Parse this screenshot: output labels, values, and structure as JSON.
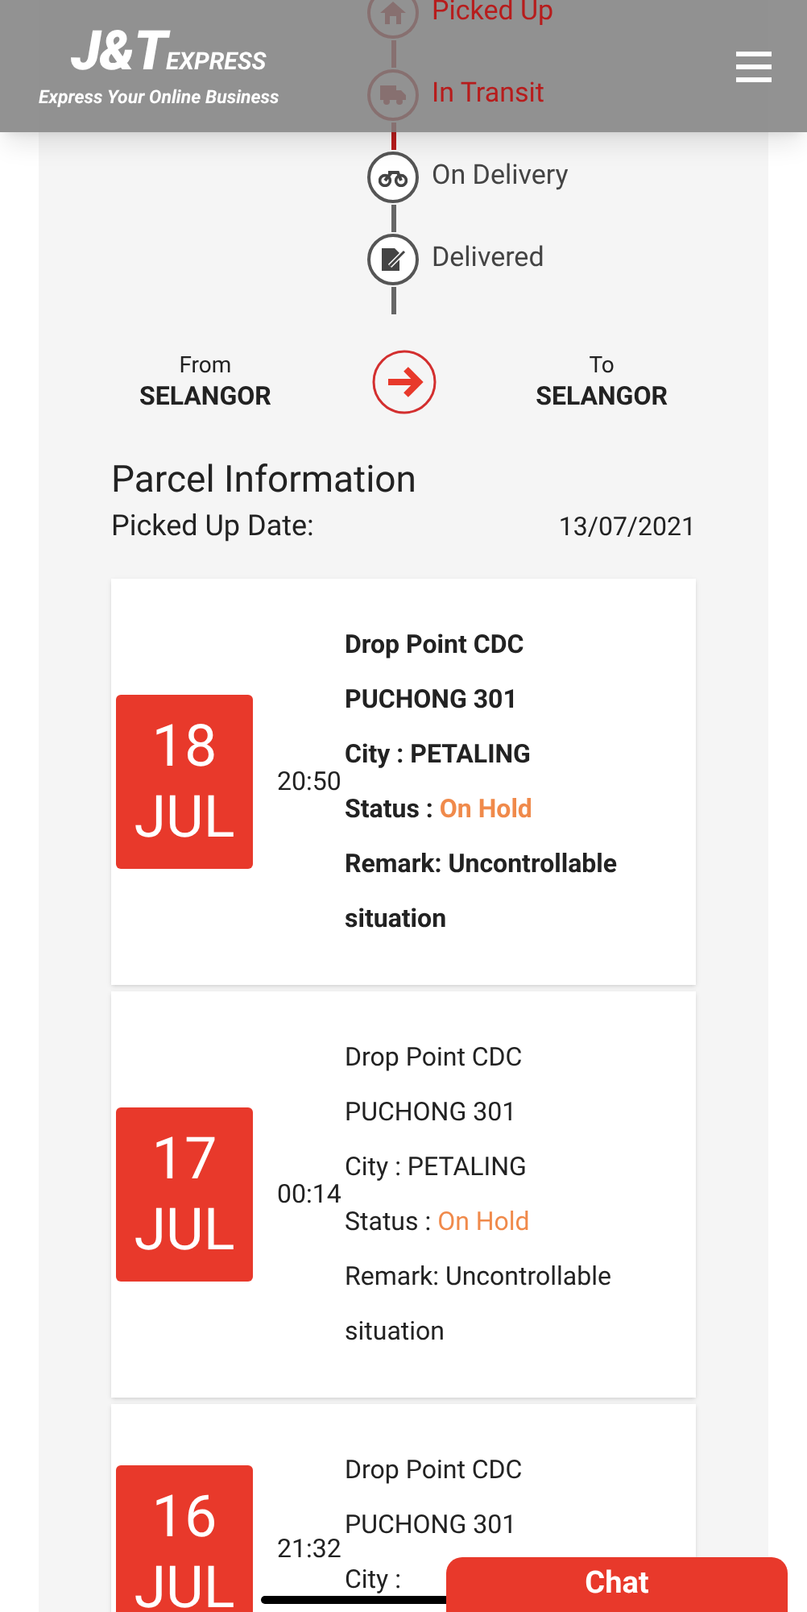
{
  "header": {
    "logo_text": "J&T",
    "logo_suffix": "EXPRESS",
    "tagline": "Express Your Online Business"
  },
  "timeline": [
    {
      "kind": "house",
      "label": "Picked Up",
      "done": true
    },
    {
      "kind": "truck",
      "label": "In Transit",
      "done": true
    },
    {
      "kind": "motorbike",
      "label": "On Delivery",
      "done": false
    },
    {
      "kind": "signature",
      "label": "Delivered",
      "done": false
    }
  ],
  "route": {
    "from_label": "From",
    "from": "SELANGOR",
    "to_label": "To",
    "to": "SELANGOR"
  },
  "parcel": {
    "title": "Parcel Information",
    "picked_up_label": "Picked Up Date:",
    "picked_up_date": "13/07/2021"
  },
  "events": [
    {
      "day": "18",
      "month": "JUL",
      "time": "20:50",
      "latest": true,
      "lines": [
        "Drop Point CDC",
        "PUCHONG 301",
        "City : PETALING"
      ],
      "status_label": "Status : ",
      "status": "On Hold",
      "remark": "Remark: Uncontrollable",
      "remark_cont": "situation"
    },
    {
      "day": "17",
      "month": "JUL",
      "time": "00:14",
      "latest": false,
      "lines": [
        "Drop Point CDC",
        "PUCHONG 301",
        "City : PETALING"
      ],
      "status_label": "Status : ",
      "status": "On Hold",
      "remark": "Remark: Uncontrollable",
      "remark_cont": "situation"
    },
    {
      "day": "16",
      "month": "JUL",
      "time": "21:32",
      "latest": false,
      "lines": [
        "Drop Point CDC",
        "PUCHONG 301",
        "City :"
      ]
    }
  ],
  "chat": {
    "label": "Chat"
  }
}
